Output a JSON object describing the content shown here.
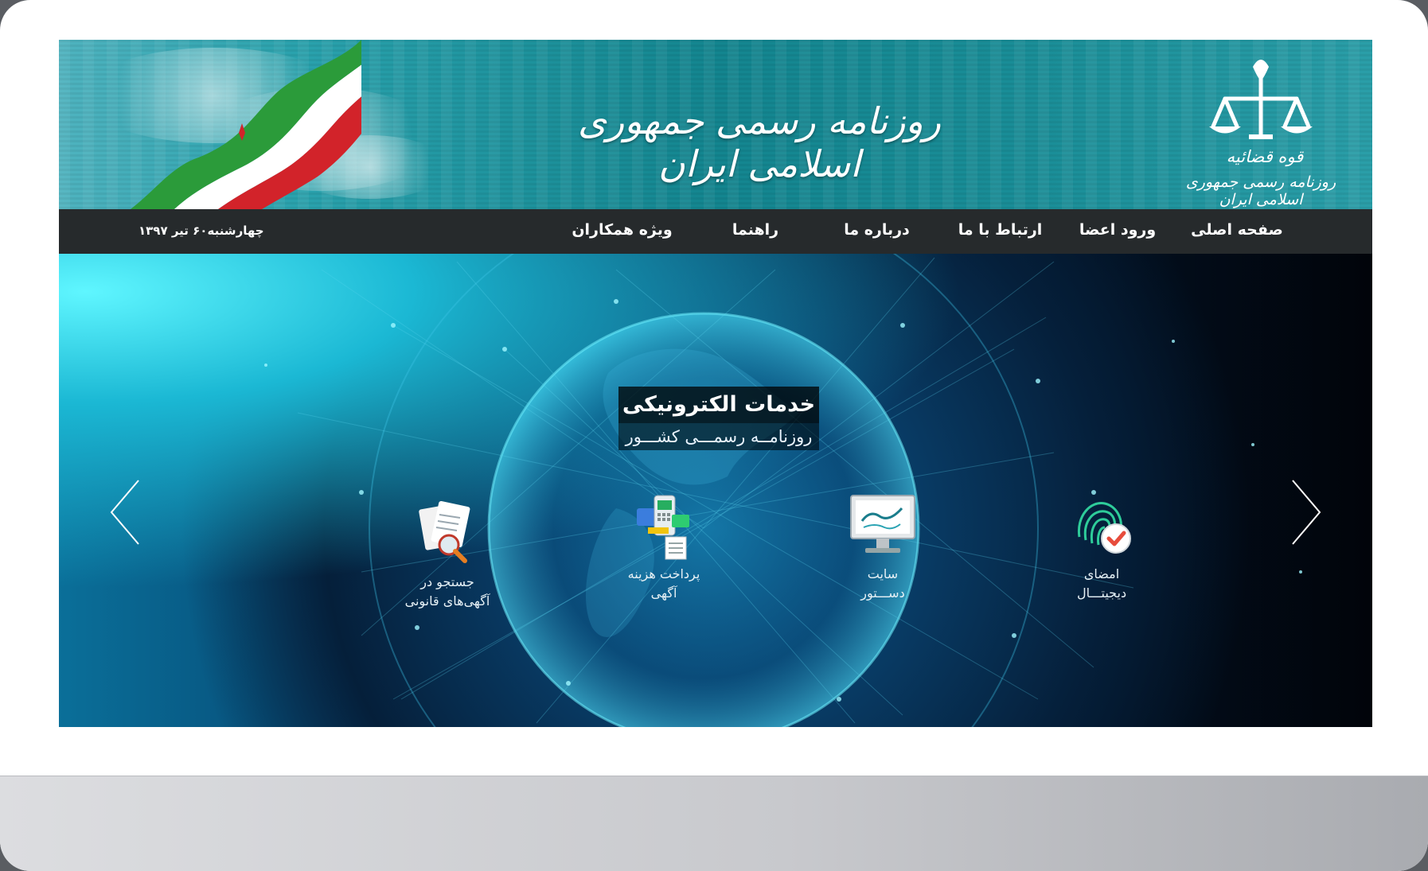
{
  "header": {
    "title": "روزنامه رسمی جمهوری اسلامی ایران",
    "emblem_org": "قوه قضائیه",
    "emblem_caption": "روزنامه رسمی جمهوری اسلامی ایران"
  },
  "nav": {
    "items": [
      {
        "label": "صفحه اصلی"
      },
      {
        "label": "ورود اعضا"
      },
      {
        "label": "ارتباط با ما"
      },
      {
        "label": "درباره ما"
      },
      {
        "label": "راهنما"
      },
      {
        "label": "ویژه همکاران"
      }
    ],
    "date": "چهارشنبه۶۰ تیر ۱۳۹۷"
  },
  "hero": {
    "title": "خدمات الکترونیکی",
    "subtitle": "روزنامــه رسمـــی کشـــور",
    "services": [
      {
        "icon": "fingerprint-check-icon",
        "line1": "امضای",
        "line2": "دیجیتـــال"
      },
      {
        "icon": "monitor-icon",
        "line1": "سایت",
        "line2": "دســـتور"
      },
      {
        "icon": "payment-icon",
        "line1": "پرداخت هزینه",
        "line2": "آگهی"
      },
      {
        "icon": "document-search-icon",
        "line1": "جستجو در",
        "line2": "آگهی‌های قانونی"
      }
    ],
    "prev_icon": "chevron-left-icon",
    "next_icon": "chevron-right-icon"
  },
  "colors": {
    "banner": "#13858f",
    "navbar": "#262a2c",
    "hero_dark": "#031a33",
    "accent_cyan": "#5ff6ff"
  }
}
